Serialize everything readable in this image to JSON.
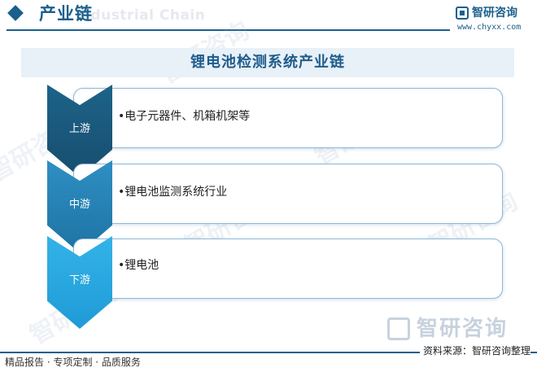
{
  "header": {
    "title": "产业链",
    "watermark_en": "Industrial Chain",
    "logo_text": "智研咨询",
    "logo_url": "www.chyxx.com"
  },
  "main_title": "锂电池检测系统产业链",
  "stages": [
    {
      "label": "上游",
      "content": "•电子元器件、机箱机架等"
    },
    {
      "label": "中游",
      "content": "•锂电池监测系统行业"
    },
    {
      "label": "下游",
      "content": "•锂电池"
    }
  ],
  "watermark": {
    "text": "智研咨询"
  },
  "footer": {
    "left": "精品报告 · 专项定制 · 品质服务",
    "right": "资料来源：智研咨询整理"
  },
  "colors": {
    "brand": "#1b5f8c",
    "upstream": "#1e6389",
    "midstream": "#2f8fc3",
    "downstream": "#33b3e8",
    "title_band": "#e8f0f8"
  },
  "icons": {
    "header": "diamond-icon",
    "logo": "logo-icon"
  }
}
